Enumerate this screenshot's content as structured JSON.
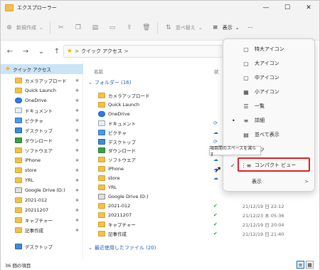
{
  "window": {
    "title": "エクスプローラー",
    "min": "—",
    "max": "☐",
    "close": "✕"
  },
  "toolbar": {
    "new_label": "新規作成",
    "sort_label": "並べ替え",
    "view_label": "表示",
    "more_label": "···"
  },
  "nav": {
    "address_label": "クイック アクセス",
    "address_sep": ">"
  },
  "sidebar": {
    "items": [
      {
        "label": "クイック アクセス",
        "icon": "star-icon"
      },
      {
        "label": "カメラアップロード",
        "icon": "folder-icon"
      },
      {
        "label": "Quick Launch",
        "icon": "folder-icon"
      },
      {
        "label": "OneDrive",
        "icon": "cloud-icon"
      },
      {
        "label": "ドキュメント",
        "icon": "documents-icon"
      },
      {
        "label": "ピクチャ",
        "icon": "pictures-icon"
      },
      {
        "label": "デスクトップ",
        "icon": "desktop-icon"
      },
      {
        "label": "ダウンロード",
        "icon": "download-icon"
      },
      {
        "label": "ソフトウエア",
        "icon": "folder-icon"
      },
      {
        "label": "iPhone",
        "icon": "folder-icon"
      },
      {
        "label": "store",
        "icon": "folder-icon"
      },
      {
        "label": "YRL",
        "icon": "folder-icon"
      },
      {
        "label": "Google Drive (D:)",
        "icon": "drive-icon"
      },
      {
        "label": "2021-012",
        "icon": "folder-icon"
      },
      {
        "label": "20211207",
        "icon": "folder-icon"
      },
      {
        "label": "キャプチャー",
        "icon": "folder-icon"
      },
      {
        "label": "記事作成",
        "icon": "folder-icon"
      },
      {
        "label": "デスクトップ",
        "icon": "desktop-icon"
      }
    ]
  },
  "main": {
    "col_name": "名前",
    "col_status": "状",
    "group_folders": "フォルダー (16)",
    "group_recent": "最近使用したファイル (20)",
    "rows": [
      {
        "name": "カメラアップロード",
        "icon": "folder-icon",
        "status": "",
        "date": ""
      },
      {
        "name": "Quick Launch",
        "icon": "folder-icon",
        "status": "",
        "date": ""
      },
      {
        "name": "OneDrive",
        "icon": "cloud-icon",
        "status": "",
        "date": ""
      },
      {
        "name": "ドキュメント",
        "icon": "documents-icon",
        "status": "sync",
        "date": ""
      },
      {
        "name": "ピクチャ",
        "icon": "pictures-icon",
        "status": "cloud",
        "date": ""
      },
      {
        "name": "デスクトップ",
        "icon": "desktop-icon",
        "status": "sync",
        "date": ""
      },
      {
        "name": "ダウンロード",
        "icon": "download-icon",
        "status": "",
        "date": ""
      },
      {
        "name": "ソフトウエア",
        "icon": "folder-icon",
        "status": "cloud",
        "date": ""
      },
      {
        "name": "iPhone",
        "icon": "folder-icon",
        "status": "cloud",
        "date": ""
      },
      {
        "name": "store",
        "icon": "folder-icon",
        "status": "cloud",
        "date": "21/12/19 日 22:18"
      },
      {
        "name": "YRL",
        "icon": "folder-icon",
        "status": "",
        "date": ""
      },
      {
        "name": "Google Drive (D:)",
        "icon": "drive-icon",
        "status": "",
        "date": ""
      },
      {
        "name": "2021-012",
        "icon": "folder-icon",
        "status": "ok",
        "date": "21/12/19 日 22:12"
      },
      {
        "name": "20211207",
        "icon": "folder-icon",
        "status": "ok",
        "date": "21/12/23 木 05:36"
      },
      {
        "name": "キャプチャー",
        "icon": "folder-icon",
        "status": "ok",
        "date": "21/12/19 日 20:04"
      },
      {
        "name": "記事作成",
        "icon": "folder-icon",
        "status": "ok",
        "date": "21/12/19 日 21:40"
      }
    ]
  },
  "menu": {
    "items": [
      {
        "label": "特大アイコン",
        "icon": "square-icon"
      },
      {
        "label": "大アイコン",
        "icon": "square-icon"
      },
      {
        "label": "中アイコン",
        "icon": "square-icon"
      },
      {
        "label": "小アイコン",
        "icon": "grid-icon"
      },
      {
        "label": "一覧",
        "icon": "list-icon"
      },
      {
        "label": "詳細",
        "icon": "details-icon"
      },
      {
        "label": "並べて表示",
        "icon": "tiles-icon"
      },
      {
        "label": "ンツ",
        "icon": "content-icon"
      },
      {
        "label": "コンパクト ビュー",
        "icon": "compact-icon"
      },
      {
        "label": "表示",
        "icon": ""
      }
    ],
    "selected_bullet": "•",
    "checked_mark": "✓",
    "submenu_arrow": ">"
  },
  "tooltip": "項目間のスペースを減らす",
  "statusbar": {
    "count": "36 個の項目"
  }
}
